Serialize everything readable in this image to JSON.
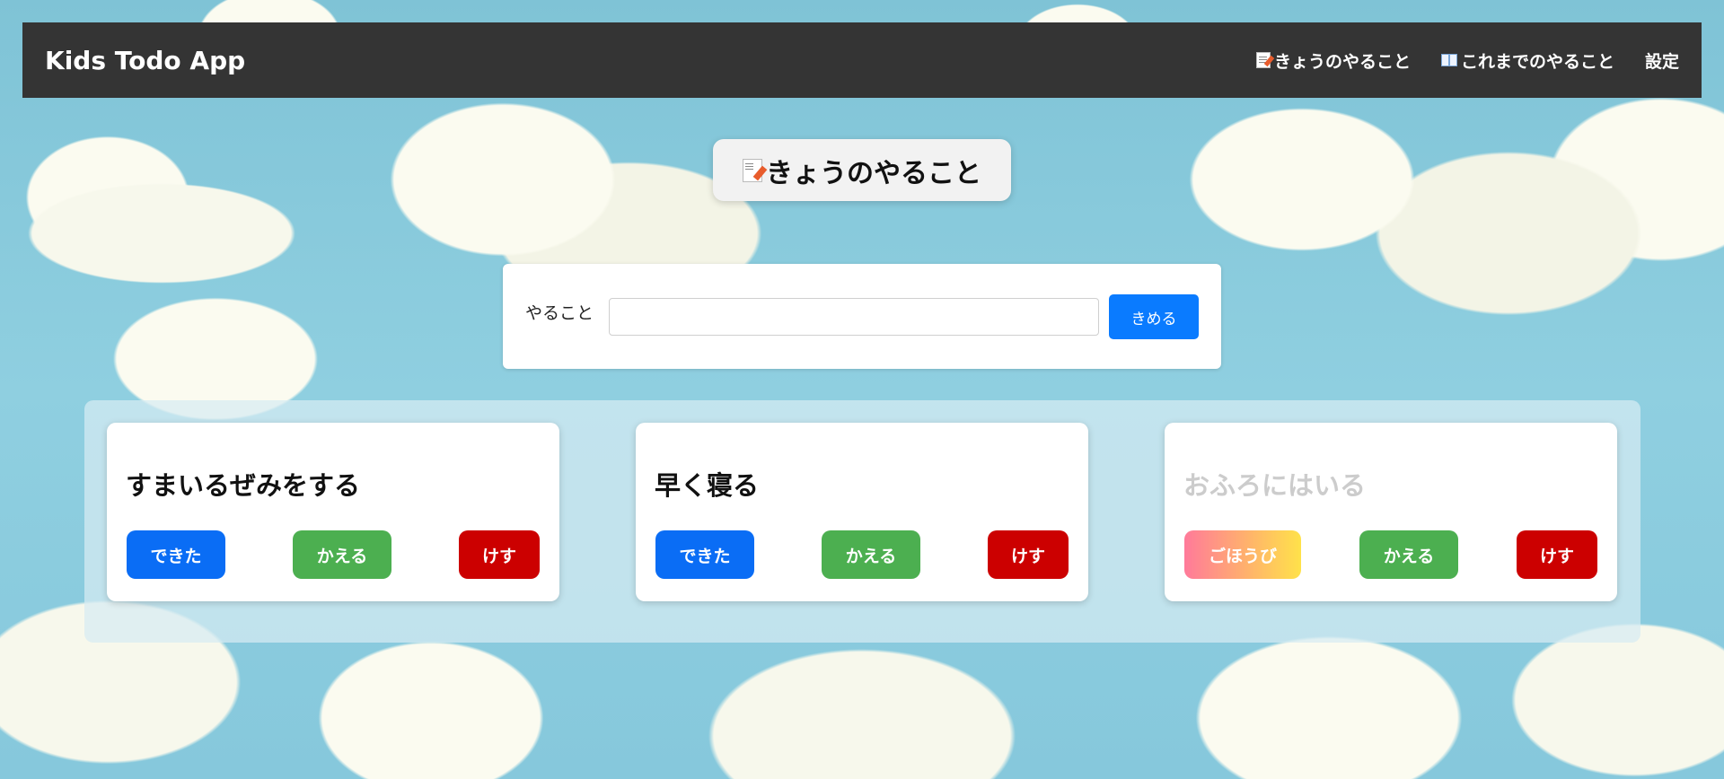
{
  "app": {
    "brand": "Kids Todo App"
  },
  "nav": {
    "items": [
      {
        "label": "きょうのやること",
        "icon": "memo-icon"
      },
      {
        "label": "これまでのやること",
        "icon": "book-icon"
      },
      {
        "label": "設定"
      }
    ]
  },
  "page": {
    "title": "きょうのやること",
    "title_icon": "memo-icon"
  },
  "form": {
    "label": "やること",
    "input_value": "",
    "submit_label": "きめる"
  },
  "todos": [
    {
      "title": "すまいるぜみをする",
      "done": false,
      "primary_label": "できた",
      "edit_label": "かえる",
      "delete_label": "けす"
    },
    {
      "title": "早く寝る",
      "done": false,
      "primary_label": "できた",
      "edit_label": "かえる",
      "delete_label": "けす"
    },
    {
      "title": "おふろにはいる",
      "done": true,
      "primary_label": "ごほうび",
      "edit_label": "かえる",
      "delete_label": "けす"
    }
  ],
  "colors": {
    "navbar": "#343434",
    "primary": "#0a6df5",
    "edit": "#4caf50",
    "delete": "#cc0000",
    "done_text": "#cccccc"
  }
}
